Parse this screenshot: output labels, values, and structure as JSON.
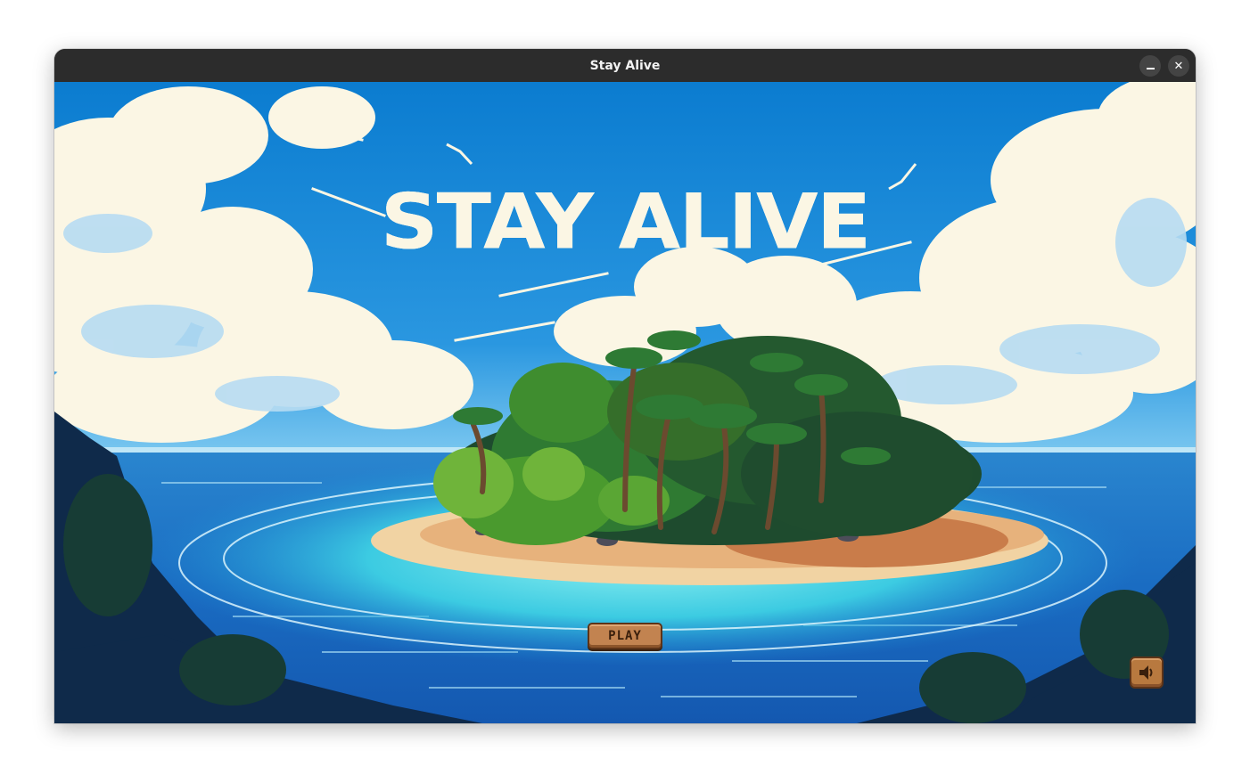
{
  "window": {
    "title": "Stay Alive"
  },
  "game": {
    "title": "STAY ALIVE",
    "play_label": "PLAY",
    "sound_icon": "speaker-icon"
  },
  "colors": {
    "sky": "#1b84d2",
    "cloud": "#fbf6e4",
    "ocean": "#1d6fc1",
    "lagoon": "#3ad0e0",
    "sand": "#e7b27c",
    "button": "#c28350"
  }
}
